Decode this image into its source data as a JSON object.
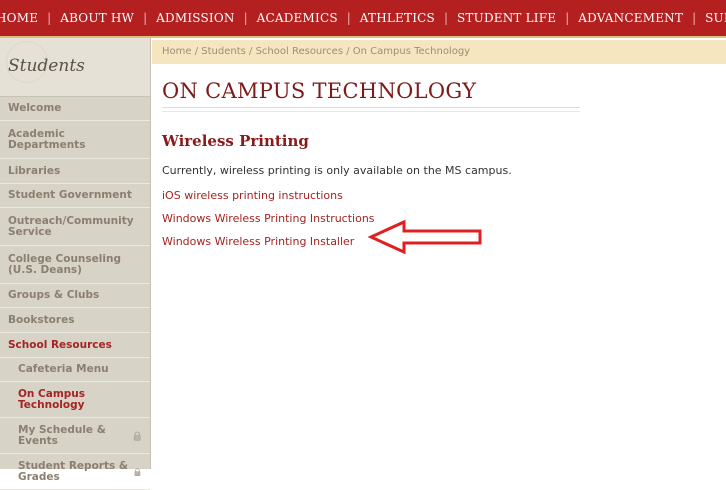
{
  "top_nav": {
    "items": [
      "HOME",
      "ABOUT HW",
      "ADMISSION",
      "ACADEMICS",
      "ATHLETICS",
      "STUDENT LIFE",
      "ADVANCEMENT",
      "SUMMER"
    ],
    "colors": {
      "bar": "#b3201f",
      "text": "#ffffff"
    }
  },
  "sidebar": {
    "title": "Students",
    "items": [
      {
        "label": "Welcome"
      },
      {
        "label": "Academic Departments"
      },
      {
        "label": "Libraries"
      },
      {
        "label": "Student Government"
      },
      {
        "label": "Outreach/Community Service"
      },
      {
        "label": "College Counseling (U.S. Deans)"
      },
      {
        "label": "Groups & Clubs"
      },
      {
        "label": "Bookstores"
      },
      {
        "label": "School Resources"
      },
      {
        "label": "Cafeteria Menu"
      },
      {
        "label": "On Campus Technology"
      },
      {
        "label": "My Schedule & Events",
        "icon": "lock-icon"
      },
      {
        "label": "Student Reports & Grades",
        "icon": "lock-icon"
      }
    ]
  },
  "breadcrumb": {
    "home": "Home",
    "students": "Students",
    "school_resources": "School Resources",
    "current": "On Campus Technology",
    "sep": " / "
  },
  "main": {
    "page_title": "ON CAMPUS TECHNOLOGY",
    "section_title": "Wireless Printing",
    "intro": "Currently, wireless printing is only available on the MS campus.",
    "links": [
      "iOS wireless printing instructions",
      "Windows Wireless Printing Instructions",
      "Windows Wireless Printing Installer"
    ],
    "annotation": {
      "icon": "arrow-left-icon",
      "color": "#e02020"
    }
  }
}
